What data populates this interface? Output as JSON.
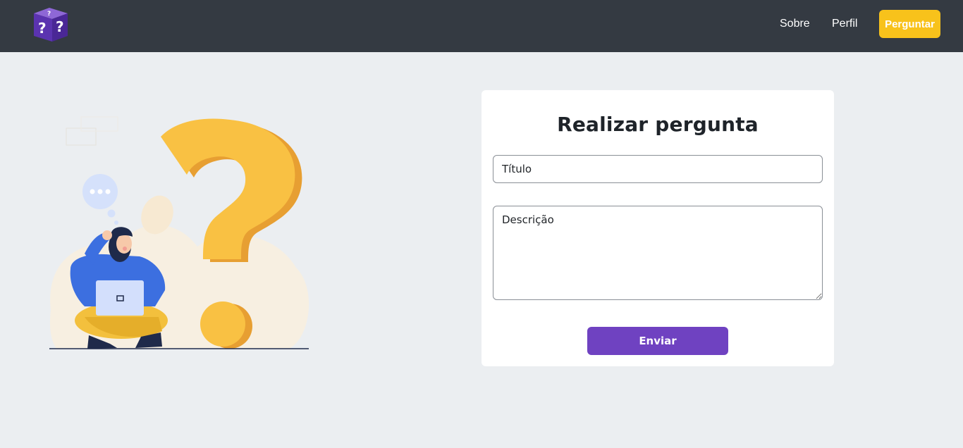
{
  "navbar": {
    "logo_icon": "question-dice-icon",
    "links": [
      {
        "label": "Sobre"
      },
      {
        "label": "Perfil"
      }
    ],
    "ask_button_label": "Perguntar"
  },
  "form": {
    "title": "Realizar pergunta",
    "title_placeholder": "Título",
    "description_placeholder": "Descrição",
    "submit_label": "Enviar"
  },
  "colors": {
    "navbar": "#343a42",
    "background": "#ebeef1",
    "ask_button": "#f8c21b",
    "submit_button": "#6f42c1",
    "question_mark": "#f9c143"
  },
  "illustration": {
    "icon": "person-with-question-mark-illustration"
  }
}
